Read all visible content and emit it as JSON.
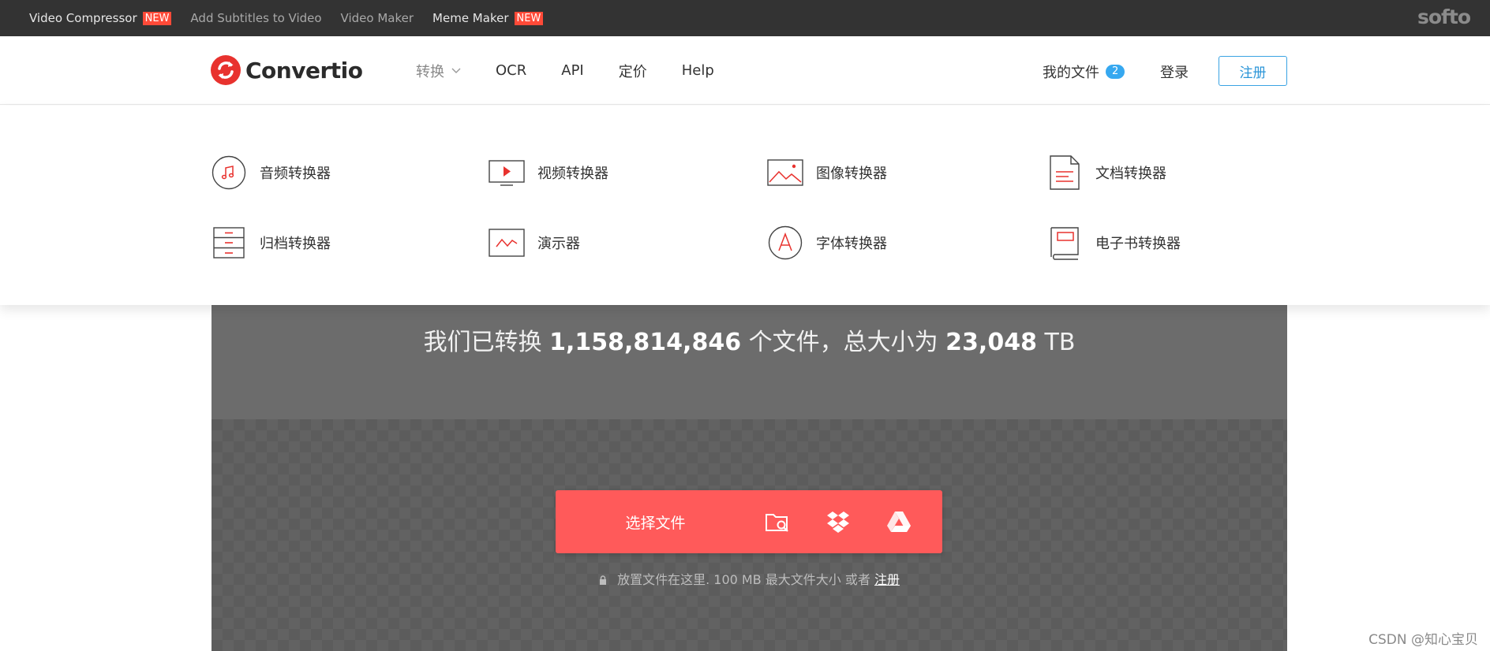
{
  "topbar": {
    "links": [
      {
        "label": "Video Compressor",
        "badge": "NEW"
      },
      {
        "label": "Add Subtitles to Video",
        "badge": ""
      },
      {
        "label": "Video Maker",
        "badge": ""
      },
      {
        "label": "Meme Maker",
        "badge": "NEW"
      }
    ],
    "brand": "softo"
  },
  "header": {
    "logo_text": "Convertio",
    "nav": [
      "转换",
      "OCR",
      "API",
      "定价",
      "Help"
    ],
    "my_files": "我的文件",
    "my_files_count": "2",
    "login": "登录",
    "signup": "注册"
  },
  "dropdown": {
    "categories": [
      {
        "label": "音频转换器",
        "icon": "audio-icon"
      },
      {
        "label": "视频转换器",
        "icon": "video-icon"
      },
      {
        "label": "图像转换器",
        "icon": "image-icon"
      },
      {
        "label": "文档转换器",
        "icon": "document-icon"
      },
      {
        "label": "归档转换器",
        "icon": "archive-icon"
      },
      {
        "label": "演示器",
        "icon": "presentation-icon"
      },
      {
        "label": "字体转换器",
        "icon": "font-icon"
      },
      {
        "label": "电子书转换器",
        "icon": "ebook-icon"
      }
    ]
  },
  "hero": {
    "stats_prefix": "我们已转换",
    "files_count": "1,158,814,846",
    "stats_middle": "个文件，总大小为",
    "total_size": "23,048",
    "size_unit": "TB",
    "choose_files": "选择文件",
    "hint_text": "放置文件在这里. 100 MB 最大文件大小 或者",
    "hint_link": "注册"
  },
  "watermark": "CSDN @知心宝贝",
  "colors": {
    "accent": "#ff5a5a",
    "topbar": "#333333",
    "badge_new": "#ff4a38",
    "count_badge": "#36a8f0",
    "signup_border": "#3aa3e3"
  }
}
